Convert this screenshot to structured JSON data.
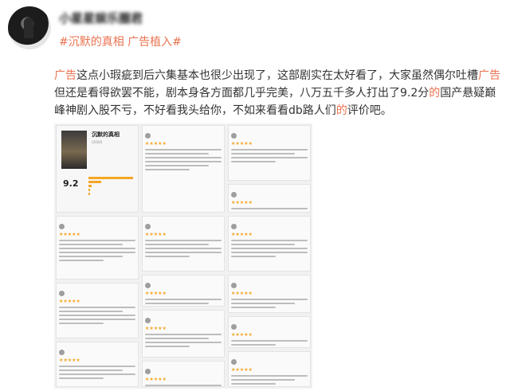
{
  "user": {
    "name": "小星星娱乐圈君"
  },
  "tags": "#沉默的真相 广告植入#",
  "post": {
    "hl1": "广告",
    "t1": "这点小瑕疵到后六集基本也很少出现了，这部剧实在太好看了，大家虽然偶尔吐槽",
    "hl2": "广告",
    "t2": "但还是看得欲罢不能，剧本身各方面都几乎完美，八万五千多人打出了9.2分",
    "hl3": "的",
    "t3": "国产悬疑巅峰神剧入股不亏，不好看我头给你，不如来看看db路人们",
    "hl4": "的",
    "t4": "评价吧。"
  },
  "collage": {
    "drama_title": "沉默的真相",
    "drama_year": "(2020)",
    "score": "9.2"
  },
  "colors": {
    "accent": "#eb7350",
    "text": "#333333",
    "star": "#f5a623"
  }
}
